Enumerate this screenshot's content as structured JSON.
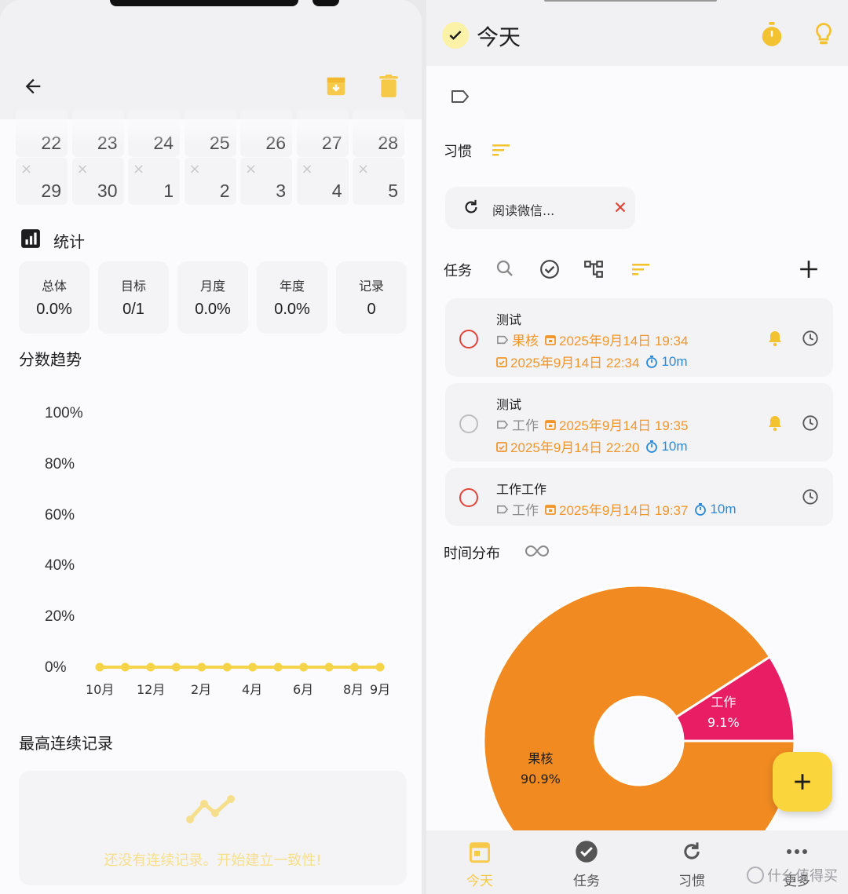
{
  "left": {
    "calendar": {
      "row1": [
        "22",
        "23",
        "24",
        "25",
        "26",
        "27",
        "28"
      ],
      "row2": [
        "29",
        "30",
        "1",
        "2",
        "3",
        "4",
        "5"
      ]
    },
    "stats_title": "统计",
    "stats": [
      {
        "label": "总体",
        "value": "0.0%"
      },
      {
        "label": "目标",
        "value": "0/1"
      },
      {
        "label": "月度",
        "value": "0.0%"
      },
      {
        "label": "年度",
        "value": "0.0%"
      },
      {
        "label": "记录",
        "value": "0"
      }
    ],
    "trend_title": "分数趋势",
    "chart_data": {
      "type": "line",
      "yticks": [
        "100%",
        "80%",
        "60%",
        "40%",
        "20%",
        "0%"
      ],
      "xticks": [
        "10月",
        "12月",
        "2月",
        "4月",
        "6月",
        "8月",
        "9月"
      ],
      "x": [
        "10月",
        "11月",
        "12月",
        "1月",
        "2月",
        "3月",
        "4月",
        "5月",
        "6月",
        "7月",
        "8月",
        "9月"
      ],
      "values": [
        0,
        0,
        0,
        0,
        0,
        0,
        0,
        0,
        0,
        0,
        0,
        0
      ],
      "ylim": [
        0,
        100
      ],
      "color": "#f5d44a"
    },
    "streak_title": "最高连续记录",
    "streak_empty": "还没有连续记录。开始建立一致性!"
  },
  "right": {
    "title": "今天",
    "habits_title": "习惯",
    "habit_chip": "阅读微信...",
    "tasks_title": "任务",
    "tasks": [
      {
        "title": "测试",
        "tag": "果核",
        "start": "2025年9月14日 19:34",
        "end": "2025年9月14日 22:34",
        "duration": "10m"
      },
      {
        "title": "测试",
        "tag": "工作",
        "start": "2025年9月14日 19:35",
        "end": "2025年9月14日 22:20",
        "duration": "10m"
      },
      {
        "title": "工作工作",
        "tag": "工作",
        "start": "2025年9月14日 19:37",
        "duration": "10m"
      }
    ],
    "distribution_title": "时间分布",
    "pie_chart": {
      "type": "pie",
      "slices": [
        {
          "name": "果核",
          "value": 90.9,
          "label": "90.9%",
          "color": "#f08a21"
        },
        {
          "name": "工作",
          "value": 9.1,
          "label": "9.1%",
          "color": "#e91d63"
        }
      ]
    },
    "nav": [
      {
        "label": "今天",
        "color": "#f7c948"
      },
      {
        "label": "任务",
        "color": "#555"
      },
      {
        "label": "习惯",
        "color": "#555"
      },
      {
        "label": "更多",
        "color": "#555"
      }
    ],
    "watermark": "什么值得买"
  },
  "colors": {
    "accent": "#f7c948",
    "orange": "#f0962b",
    "blue": "#2b8ad8",
    "red": "#e0453a"
  }
}
